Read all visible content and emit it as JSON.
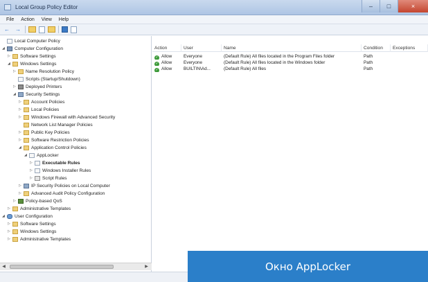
{
  "window": {
    "title": "Local Group Policy Editor",
    "min_label": "–",
    "max_label": "□",
    "close_label": "×"
  },
  "menu": [
    "File",
    "Action",
    "View",
    "Help"
  ],
  "toolbar": {
    "back": "←",
    "forward": "→"
  },
  "tree": [
    {
      "label": "Local Computer Policy",
      "icon": "doc",
      "twisty": ""
    },
    {
      "label": "Computer Configuration",
      "icon": "computer",
      "twisty": "◢"
    },
    {
      "label": "Software Settings",
      "icon": "folder",
      "twisty": "▷"
    },
    {
      "label": "Windows Settings",
      "icon": "folder",
      "twisty": "◢"
    },
    {
      "label": "Name Resolution Policy",
      "icon": "folder",
      "twisty": "▷"
    },
    {
      "label": "Scripts (Startup/Shutdown)",
      "icon": "doc",
      "twisty": ""
    },
    {
      "label": "Deployed Printers",
      "icon": "printer",
      "twisty": "▷"
    },
    {
      "label": "Security Settings",
      "icon": "shield",
      "twisty": "◢"
    },
    {
      "label": "Account Policies",
      "icon": "folder",
      "twisty": "▷"
    },
    {
      "label": "Local Policies",
      "icon": "folder",
      "twisty": "▷"
    },
    {
      "label": "Windows Firewall with Advanced Security",
      "icon": "folder",
      "twisty": "▷"
    },
    {
      "label": "Network List Manager Policies",
      "icon": "folder",
      "twisty": ""
    },
    {
      "label": "Public Key Policies",
      "icon": "folder",
      "twisty": "▷"
    },
    {
      "label": "Software Restriction Policies",
      "icon": "folder",
      "twisty": "▷"
    },
    {
      "label": "Application Control Policies",
      "icon": "folder",
      "twisty": "◢"
    },
    {
      "label": "AppLocker",
      "icon": "doc",
      "twisty": "◢"
    },
    {
      "label": "Executable Rules",
      "icon": "doc",
      "twisty": "▷"
    },
    {
      "label": "Windows Installer Rules",
      "icon": "doc",
      "twisty": "▷"
    },
    {
      "label": "Script Rules",
      "icon": "doc",
      "twisty": "▷"
    },
    {
      "label": "IP Security Policies on Local Computer",
      "icon": "shield",
      "twisty": "▷"
    },
    {
      "label": "Advanced Audit Policy Configuration",
      "icon": "folder",
      "twisty": "▷"
    },
    {
      "label": "Policy-based QoS",
      "icon": "chart",
      "twisty": "▷"
    },
    {
      "label": "Administrative Templates",
      "icon": "folder",
      "twisty": "▷"
    },
    {
      "label": "User Configuration",
      "icon": "user",
      "twisty": "◢"
    },
    {
      "label": "Software Settings",
      "icon": "folder",
      "twisty": "▷"
    },
    {
      "label": "Windows Settings",
      "icon": "folder",
      "twisty": "▷"
    },
    {
      "label": "Administrative Templates",
      "icon": "folder",
      "twisty": "▷"
    }
  ],
  "table": {
    "columns": [
      "Action",
      "User",
      "Name",
      "Condition",
      "Exceptions"
    ],
    "rows": [
      {
        "action": "Allow",
        "user": "Everyone",
        "name": "(Default Rule) All files located in the Program Files folder",
        "condition": "Path",
        "exceptions": ""
      },
      {
        "action": "Allow",
        "user": "Everyone",
        "name": "(Default Rule) All files located in the Windows folder",
        "condition": "Path",
        "exceptions": ""
      },
      {
        "action": "Allow",
        "user": "BUILTIN\\Ad...",
        "name": "(Default Rule) All files",
        "condition": "Path",
        "exceptions": ""
      }
    ]
  },
  "scrollbar": {
    "left_arrow": "◀",
    "right_arrow": "▶"
  },
  "caption": "Окно AppLocker"
}
